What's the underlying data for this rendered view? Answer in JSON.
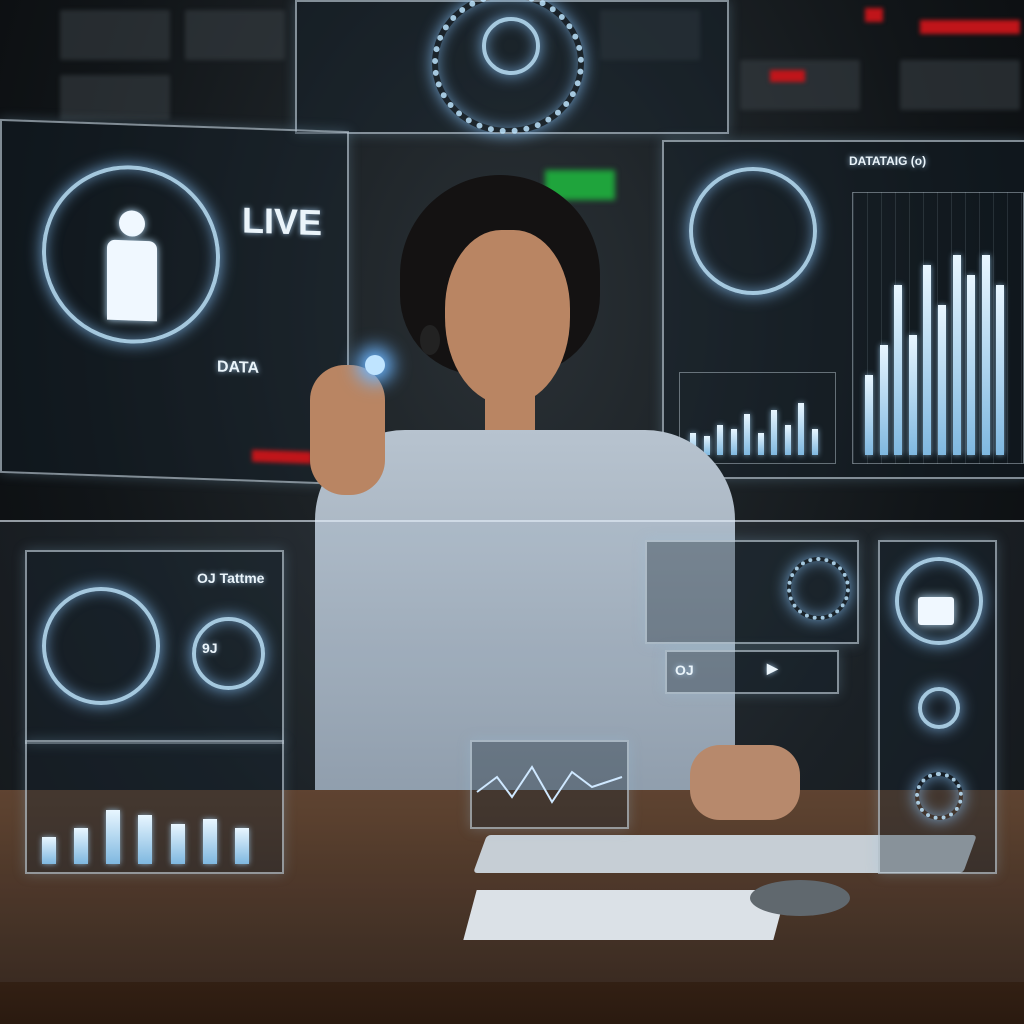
{
  "scene": {
    "left_panel": {
      "live_label": "LIVE",
      "data_label": "DATA",
      "icon": "person-icon"
    },
    "lower_left_panel": {
      "label": "OJ Tattme",
      "dial_label": "9J"
    },
    "right_panel": {
      "header_label": "DATATAIG (o)"
    },
    "lower_right_panel": {
      "button_label": "OJ",
      "icon": "padlock-icon"
    },
    "right_chart_bars": [
      40,
      55,
      85,
      60,
      95,
      75,
      100,
      90,
      100,
      85
    ],
    "mid_chart_bars": [
      30,
      25,
      40,
      35,
      55,
      30,
      60,
      40,
      70,
      35
    ],
    "low_chart_bars": [
      30,
      40,
      60,
      55,
      45,
      50,
      40
    ],
    "colors": {
      "hologram": "#bfe4ff",
      "alert": "#c0151a",
      "desk": "#5a3a24",
      "shirt": "#a9b6c3"
    }
  }
}
